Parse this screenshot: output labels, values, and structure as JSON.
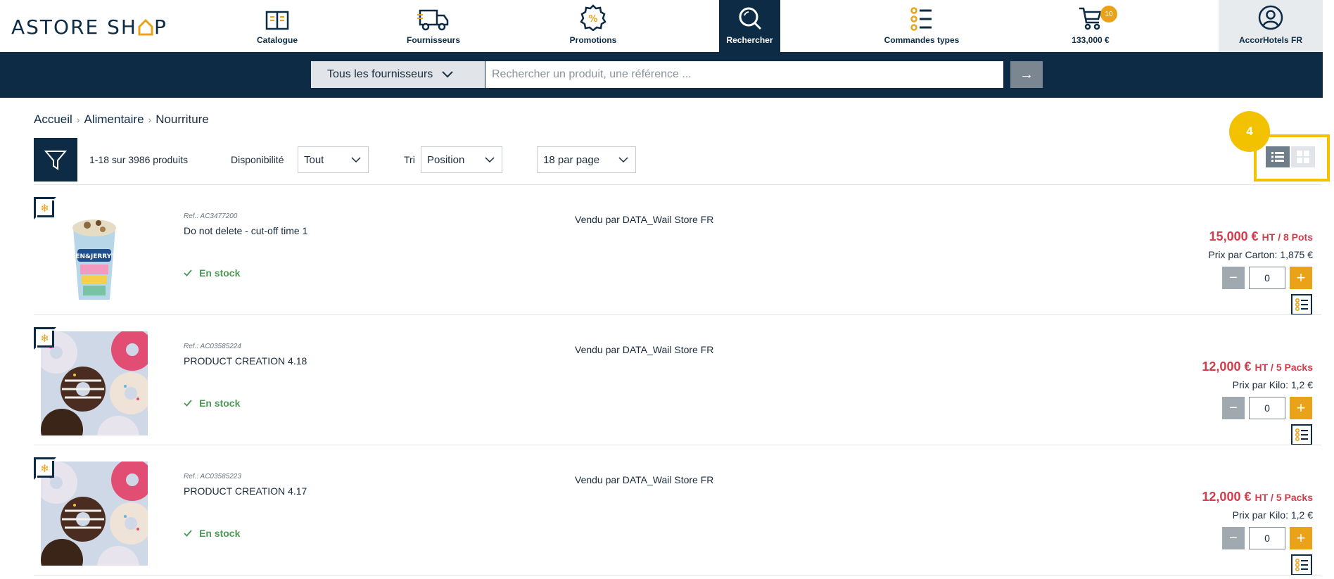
{
  "header": {
    "logo": "ASTORE SHOP",
    "nav": [
      {
        "label": "Catalogue",
        "icon": "book-icon"
      },
      {
        "label": "Fournisseurs",
        "icon": "truck-icon"
      },
      {
        "label": "Promotions",
        "icon": "percent-badge-icon"
      },
      {
        "label": "Rechercher",
        "icon": "search-icon",
        "active": true
      },
      {
        "label": "Commandes types",
        "icon": "list-icon"
      },
      {
        "label": "133,000 €",
        "icon": "cart-icon",
        "badge": "10"
      },
      {
        "label": "AccorHotels FR",
        "icon": "user-icon"
      }
    ]
  },
  "search": {
    "supplier_label": "Tous les fournisseurs",
    "placeholder": "Rechercher un produit, une référence ...",
    "go_label": "→"
  },
  "breadcrumb": {
    "home": "Accueil",
    "category": "Alimentaire",
    "current": "Nourriture"
  },
  "toolbar": {
    "count": "1-18 sur 3986 produits",
    "availability_label": "Disponibilité",
    "availability_value": "Tout",
    "sort_label": "Tri",
    "sort_value": "Position",
    "per_page_value": "18 par page",
    "step_badge": "4"
  },
  "products": [
    {
      "ref": "Ref.: AC3477200",
      "name": "Do not delete - cut-off time 1",
      "stock": "En stock",
      "seller": "Vendu par DATA_Wail Store FR",
      "price": "15,000 €",
      "price_unit": "HT / 8 Pots",
      "unit_price": "Prix par Carton: 1,875 €",
      "qty": "0",
      "image": "ice-cream-tub"
    },
    {
      "ref": "Ref.: AC03585224",
      "name": "PRODUCT CREATION 4.18",
      "stock": "En stock",
      "seller": "Vendu par DATA_Wail Store FR",
      "price": "12,000 €",
      "price_unit": "HT / 5 Packs",
      "unit_price": "Prix par Kilo: 1,2 €",
      "qty": "0",
      "image": "donuts"
    },
    {
      "ref": "Ref.: AC03585223",
      "name": "PRODUCT CREATION 4.17",
      "stock": "En stock",
      "seller": "Vendu par DATA_Wail Store FR",
      "price": "12,000 €",
      "price_unit": "HT / 5 Packs",
      "unit_price": "Prix par Kilo: 1,2 €",
      "qty": "0",
      "image": "donuts"
    }
  ],
  "colors": {
    "navy": "#0d2b45",
    "accent": "#eaa318",
    "price": "#d23d4c",
    "stock": "#4a9a55",
    "highlight": "#f2c200"
  }
}
